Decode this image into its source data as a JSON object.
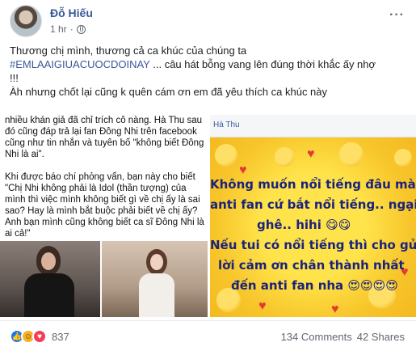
{
  "post": {
    "author": "Đỗ Hiếu",
    "time": "1 hr",
    "more": "···",
    "lines": [
      "Thương chị mình, thương cả ca khúc của chúng ta",
      "#EMLAAIGIUACUOCDOINAY",
      "... câu hát bỗng vang lên đúng thời khắc ấy nhợ",
      "!!!",
      "Àh nhưng chốt lại cũng k quên cám ơn em đã yêu thích ca khúc này"
    ]
  },
  "media": {
    "left_text": "nhiều khán giả đã chỉ trích cô nàng. Hà Thu sau đó cũng đáp trả lại fan Đông Nhi trên facebook cũng như tin nhắn và tuyên bố \"không biết Đông Nhi là ai\".\n\nKhi được báo chí phỏng vấn, bạn này cho biết \"Chị Nhi không phải là Idol (thần tượng) của mình thì việc mình không biết gì về chị ấy là sai sao? Hay là mình bắt buộc phải biết về chị ấy? Anh bạn mình cũng không biết ca sĩ Đông Nhi là ai cả!\"",
    "screenshot_name": "Hà Thu",
    "screenshot_lines": [
      "Không muốn nổi tiếng đâu mà",
      "anti fan cứ bắt nổi tiếng.. ngại",
      "ghê.. hihi 😋😋",
      "Nếu tui có nổi tiếng thì cho gửi",
      "lời cảm ơn chân thành nhất",
      "đến anti fan nha 😍😍😍😍"
    ]
  },
  "footer": {
    "reactions": [
      "like-icon",
      "haha-icon",
      "love-icon"
    ],
    "reaction_count": "837",
    "comments": "134 Comments",
    "shares": "42 Shares"
  },
  "colors": {
    "link": "#385898",
    "like": "#1877f2",
    "love": "#f33e58",
    "haha": "#f7b125",
    "screenshot_text": "#1a237e",
    "screenshot_bg": "#f7c52a"
  }
}
